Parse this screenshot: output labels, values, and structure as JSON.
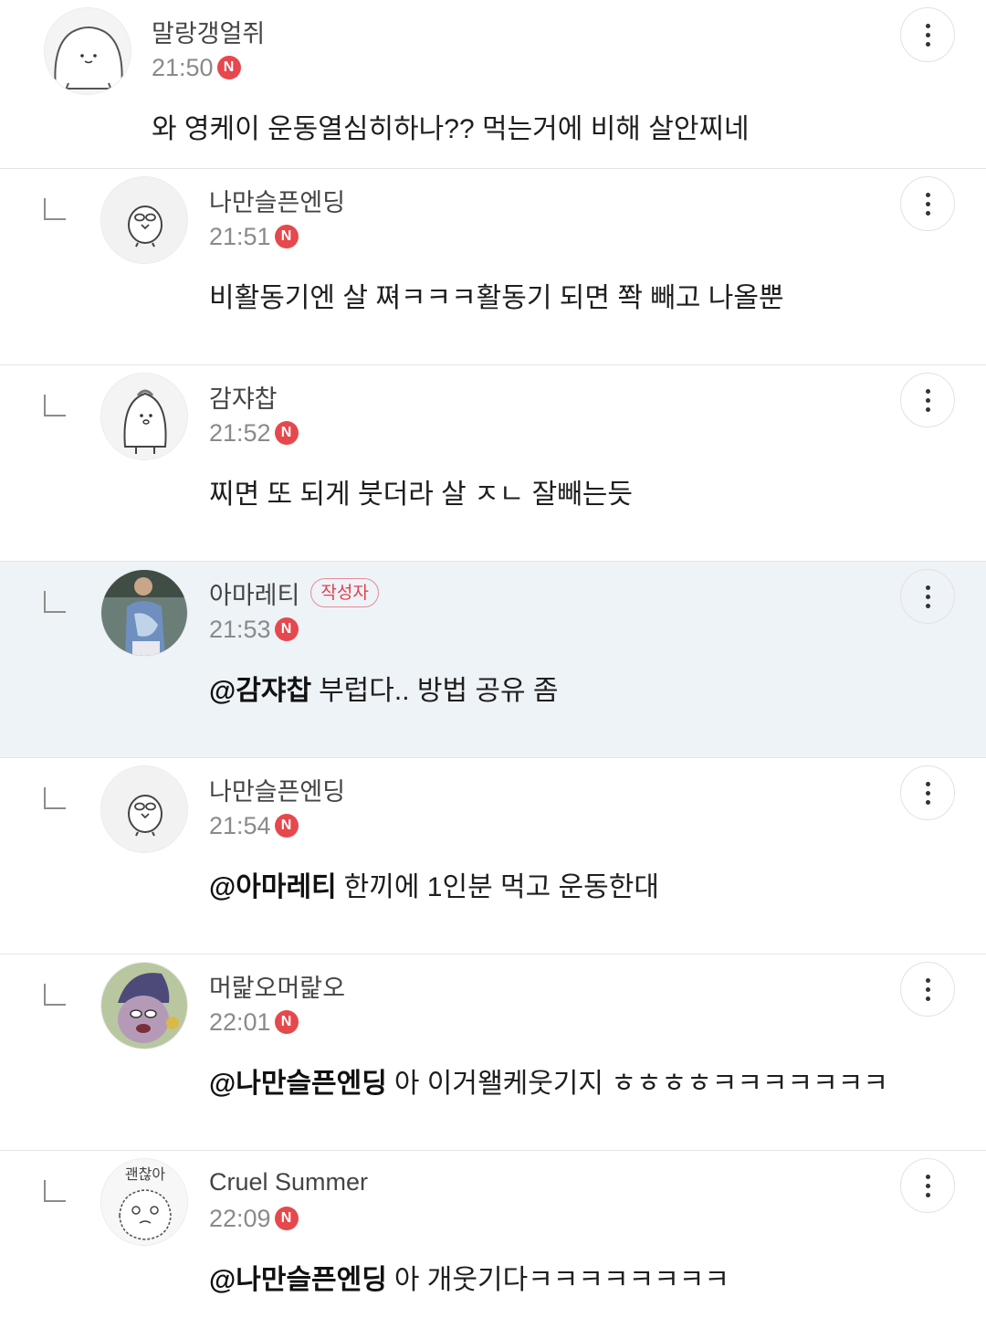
{
  "comments": [
    {
      "nickname": "말랑갱얼쥐",
      "time": "21:50",
      "new_badge": "N",
      "mention": "",
      "text": "와 영케이 운동열심히하나?? 먹는거에 비해 살안찌네"
    },
    {
      "nickname": "나만슬픈엔딩",
      "time": "21:51",
      "new_badge": "N",
      "mention": "",
      "text": "비활동기엔 살 쪄ㅋㅋㅋ활동기 되면 쫙 빼고 나올뿐"
    },
    {
      "nickname": "감쟈찹",
      "time": "21:52",
      "new_badge": "N",
      "mention": "",
      "text": "찌면 또 되게 붓더라 살 ㅈㄴ 잘빼는듯"
    },
    {
      "nickname": "아마레티",
      "author_badge": "작성자",
      "time": "21:53",
      "new_badge": "N",
      "mention": "@감쟈찹",
      "text": "부럽다.. 방법 공유 좀"
    },
    {
      "nickname": "나만슬픈엔딩",
      "time": "21:54",
      "new_badge": "N",
      "mention": "@아마레티",
      "text": "한끼에 1인분 먹고 운동한대"
    },
    {
      "nickname": "머랉오머랉오",
      "time": "22:01",
      "new_badge": "N",
      "mention": "@나만슬픈엔딩",
      "text": "아 이거왤케웃기지 ㅎㅎㅎㅎㅋㅋㅋㅋㅋㅋㅋ"
    },
    {
      "nickname": "Cruel Summer",
      "time": "22:09",
      "new_badge": "N",
      "mention": "@나만슬픈엔딩",
      "text": "아 개웃기다ㅋㅋㅋㅋㅋㅋㅋㅋ"
    }
  ],
  "avatar_text": {
    "cruel_summer": "괜찮아"
  },
  "colors": {
    "accent_new": "#e5484d",
    "author_highlight_bg": "#eef3f8",
    "author_badge": "#e0414d"
  }
}
